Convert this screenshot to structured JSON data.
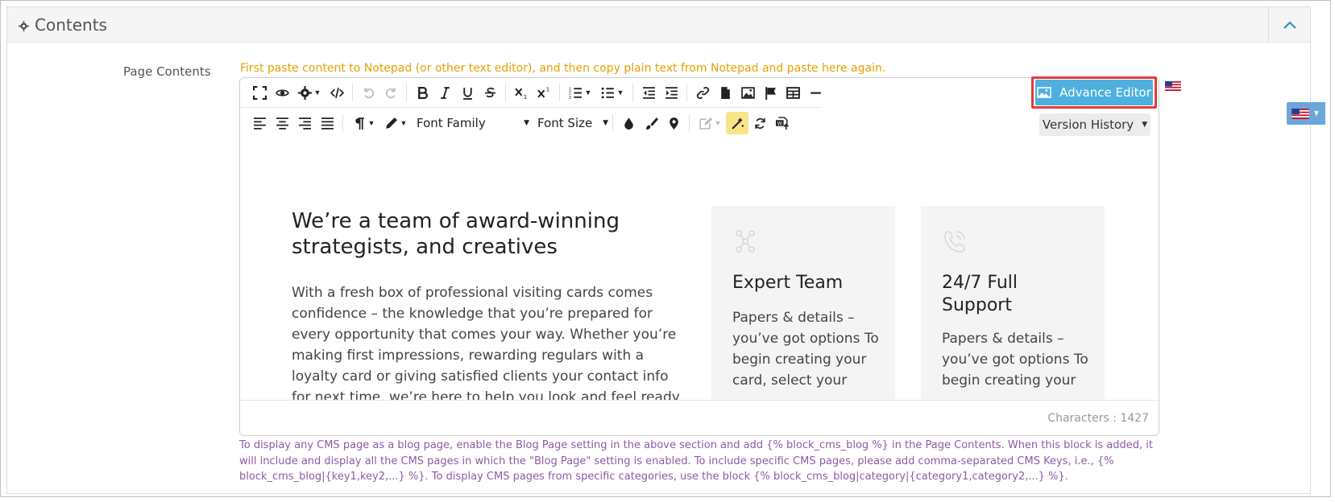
{
  "panel": {
    "title": "Contents"
  },
  "field": {
    "label": "Page Contents"
  },
  "warning": "First paste content to Notepad (or other text editor), and then copy plain text from Notepad and paste here again.",
  "toolbar": {
    "font_family": "Font Family",
    "font_size": "Font Size"
  },
  "advance_editor": {
    "label": "Advance Editor"
  },
  "version_history": {
    "label": "Version History"
  },
  "content": {
    "heading": "We’re a team of award-winning strategists, and creatives",
    "paragraph": "With a fresh box of professional visiting cards comes confidence – the knowledge that you’re prepared for every opportunity that comes your way. Whether you’re making first impressions, rewarding regulars with a loyalty card or giving satisfied clients your contact info for next time, we’re here to help you look and feel ready to impress.",
    "cards": [
      {
        "title": "Expert Team",
        "text": "Papers & details – you’ve got options To begin creating your card, select your",
        "icon": "team-icon"
      },
      {
        "title": "24/7 Full Support",
        "text": "Papers & details – you’ve got options To begin creating your",
        "icon": "phone-icon"
      }
    ]
  },
  "status": {
    "characters": "Characters : 1427"
  },
  "help": "To display any CMS page as a blog page, enable the Blog Page setting in the above section and add {% block_cms_blog %} in the Page Contents. When this block is added, it will include and display all the CMS pages in which the \"Blog Page\" setting is enabled. To include specific CMS pages, please add comma-separated CMS Keys, i.e., {% block_cms_blog|{key1,key2,...} %}. To display CMS pages from specific categories, use the block {% block_cms_blog|category|{category1,category2,...} %}.",
  "colors": {
    "accent": "#4eb0de",
    "warning": "#e6a100",
    "help_text": "#8e5aa8",
    "highlight_outline": "#e23b3b"
  }
}
